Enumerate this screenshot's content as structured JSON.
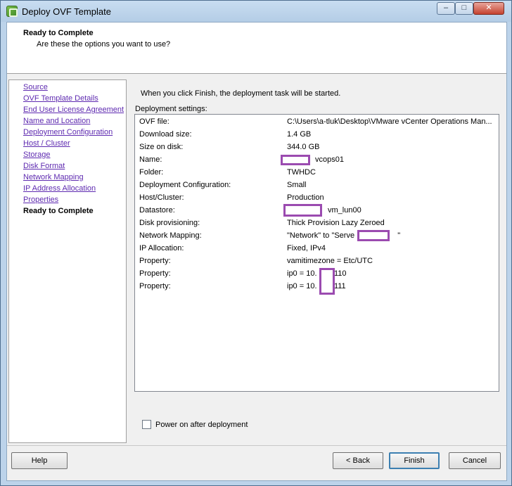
{
  "window": {
    "title": "Deploy OVF Template",
    "icon": "vmware-ovf-icon",
    "controls": {
      "minimize": "–",
      "maximize": "□",
      "close": "✕"
    }
  },
  "header": {
    "title": "Ready to Complete",
    "subtitle": "Are these the options you want to use?"
  },
  "nav": {
    "items": [
      {
        "label": "Source",
        "current": false
      },
      {
        "label": "OVF Template Details",
        "current": false
      },
      {
        "label": "End User License Agreement",
        "current": false
      },
      {
        "label": "Name and Location",
        "current": false
      },
      {
        "label": "Deployment Configuration",
        "current": false
      },
      {
        "label": "Host / Cluster",
        "current": false
      },
      {
        "label": "Storage",
        "current": false
      },
      {
        "label": "Disk Format",
        "current": false
      },
      {
        "label": "Network Mapping",
        "current": false
      },
      {
        "label": "IP Address Allocation",
        "current": false
      },
      {
        "label": "Properties",
        "current": false
      },
      {
        "label": "Ready to Complete",
        "current": true
      }
    ]
  },
  "content": {
    "intro": "When you click Finish, the deployment task will be started.",
    "settings_label": "Deployment settings:",
    "settings": [
      {
        "key": "OVF file:",
        "value": "C:\\Users\\a-tluk\\Desktop\\VMware vCenter Operations Man..."
      },
      {
        "key": "Download size:",
        "value": "1.4 GB"
      },
      {
        "key": "Size on disk:",
        "value": "344.0 GB"
      },
      {
        "key": "Name:",
        "value": "vcops01"
      },
      {
        "key": "Folder:",
        "value": "TWHDC"
      },
      {
        "key": "Deployment Configuration:",
        "value": "Small"
      },
      {
        "key": "Host/Cluster:",
        "value": "Production"
      },
      {
        "key": "Datastore:",
        "value": "vm_lun00"
      },
      {
        "key": "Disk provisioning:",
        "value": "Thick Provision Lazy Zeroed"
      },
      {
        "key": "Network Mapping:",
        "value": "\"Network\" to \"Serve                    \""
      },
      {
        "key": "IP Allocation:",
        "value": "Fixed, IPv4"
      },
      {
        "key": "Property:",
        "value": "vamitimezone = Etc/UTC"
      },
      {
        "key": "Property:",
        "value": "ip0 = 10.        110"
      },
      {
        "key": "Property:",
        "value": "ip0 = 10.        111"
      }
    ],
    "power_on": {
      "label": "Power on after deployment",
      "checked": false
    }
  },
  "buttons": {
    "help": "Help",
    "back": "< Back",
    "finish": "Finish",
    "cancel": "Cancel"
  },
  "colors": {
    "link": "#5e2ab0",
    "redaction": "#9b4bb0",
    "titlebar": "#bcd3ea"
  }
}
